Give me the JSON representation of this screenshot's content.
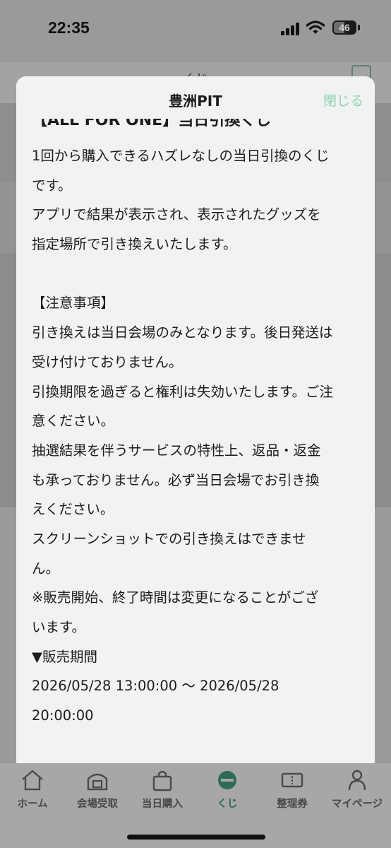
{
  "status_bar": {
    "time": "22:35",
    "battery": "46"
  },
  "background": {
    "header_title": "くじ"
  },
  "modal": {
    "title": "豊洲PIT",
    "close_label": "閉じる",
    "heading": "【ALL FOR ONE】当日引換くじ",
    "lines": [
      "1回から購入できるハズレなしの当日引換のくじ",
      "です。",
      "アプリで結果が表示され、表示されたグッズを",
      "指定場所で引き換えいたします。",
      "",
      "【注意事項】",
      "引き換えは当日会場のみとなります。後日発送は",
      "受け付けておりません。",
      "引換期限を過ぎると権利は失効いたします。ご注",
      "意ください。",
      "抽選結果を伴うサービスの特性上、返品・返金",
      "も承っておりません。必ず当日会場でお引き換",
      "えください。",
      "スクリーンショットでの引き換えはできませ",
      "ん。",
      "※販売開始、終了時間は変更になることがござ",
      "います。",
      "▼販売期間",
      "2026/05/28 13:00:00 〜 2026/05/28",
      "20:00:00"
    ]
  },
  "tabbar": {
    "tabs": [
      {
        "label": "ホーム",
        "icon": "home-icon"
      },
      {
        "label": "会場受取",
        "icon": "venue-icon"
      },
      {
        "label": "当日購入",
        "icon": "shopping-bag-icon"
      },
      {
        "label": "くじ",
        "icon": "lottery-icon",
        "active": true
      },
      {
        "label": "整理券",
        "icon": "ticket-icon"
      },
      {
        "label": "マイページ",
        "icon": "user-icon"
      }
    ]
  },
  "colors": {
    "accent": "#8fd1b4",
    "active_tab": "#2e6b55",
    "modal_bg": "#f0f3f1"
  }
}
